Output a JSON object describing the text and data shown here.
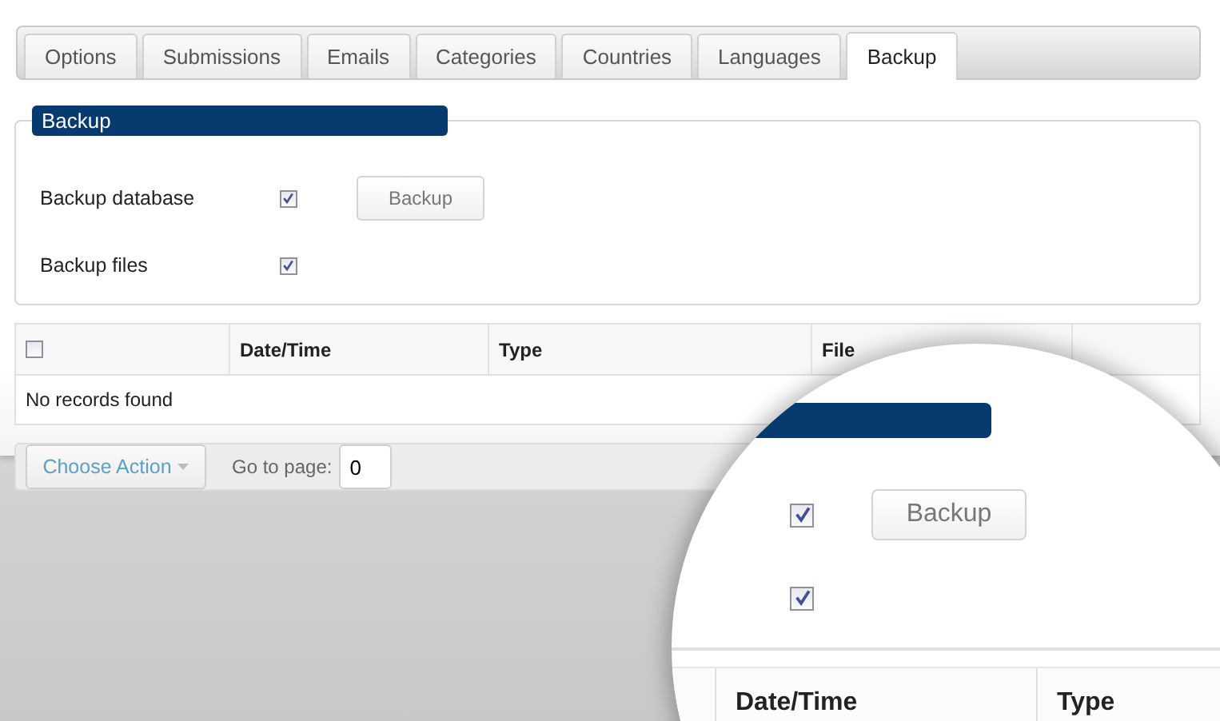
{
  "tabs": [
    {
      "label": "Options",
      "selected": false
    },
    {
      "label": "Submissions",
      "selected": false
    },
    {
      "label": "Emails",
      "selected": false
    },
    {
      "label": "Categories",
      "selected": false
    },
    {
      "label": "Countries",
      "selected": false
    },
    {
      "label": "Languages",
      "selected": false
    },
    {
      "label": "Backup",
      "selected": true
    }
  ],
  "backup_section": {
    "legend": "Backup",
    "options": [
      {
        "label": "Backup database",
        "checked": true
      },
      {
        "label": "Backup files",
        "checked": true
      }
    ],
    "button": "Backup"
  },
  "table": {
    "select_all_checked": false,
    "columns": [
      "Date/Time",
      "Type",
      "File",
      ""
    ],
    "empty_message": "No records found"
  },
  "footer": {
    "action_button": "Choose Action",
    "goto_label": "Go to page:",
    "page_value": "0"
  },
  "magnifier": {
    "options": [
      {
        "checked": true
      },
      {
        "checked": true
      }
    ],
    "button": "Backup",
    "columns": [
      "Date/Time",
      "Type"
    ]
  }
}
